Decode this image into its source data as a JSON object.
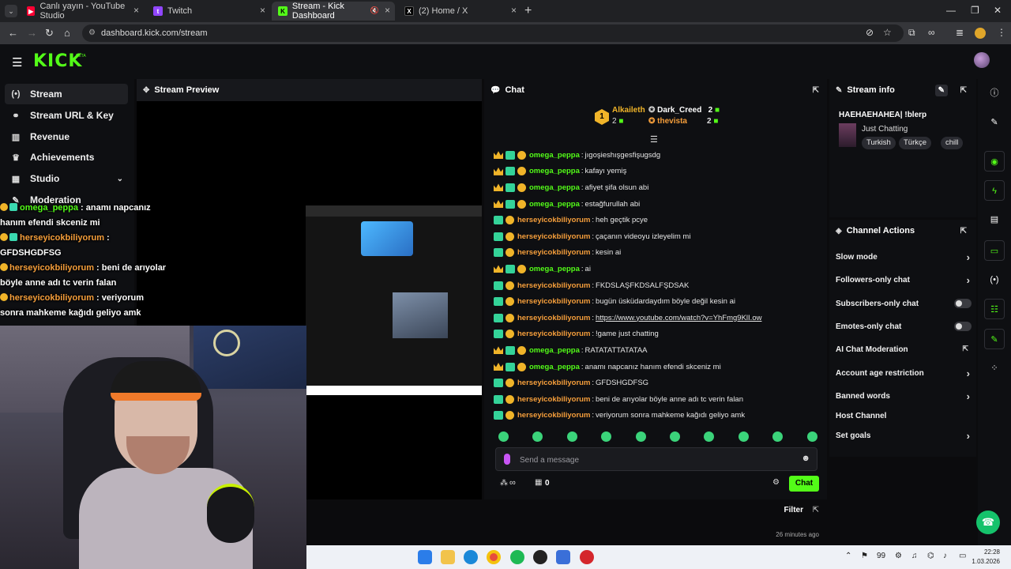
{
  "browser": {
    "tabs": [
      {
        "title": "Canlı yayın - YouTube Studio",
        "favicon_color": "#ff0033"
      },
      {
        "title": "Twitch",
        "favicon_color": "#9146ff"
      },
      {
        "title": "Stream - Kick Dashboard",
        "favicon_color": "#53fc18"
      },
      {
        "title": "(2) Home / X",
        "favicon_color": "#000000"
      }
    ],
    "url": "dashboard.kick.com/stream"
  },
  "kick": {
    "logo": "KICK",
    "beta": "BETA",
    "accent": "#53fc18"
  },
  "nav": {
    "items": [
      {
        "label": "Stream",
        "icon": "broadcast-icon"
      },
      {
        "label": "Stream URL & Key",
        "icon": "link-icon"
      },
      {
        "label": "Revenue",
        "icon": "revenue-icon"
      },
      {
        "label": "Achievements",
        "icon": "trophy-icon"
      },
      {
        "label": "Studio",
        "icon": "studio-icon"
      },
      {
        "label": "Moderation",
        "icon": "wrench-icon"
      }
    ]
  },
  "preview": {
    "title": "Stream Preview",
    "overlay": [
      {
        "user": "omega_peppa",
        "text": "anamı napcanız hanım efendi skceniz mi"
      },
      {
        "user": "herseyicokbiliyorum",
        "text": "GFDSHGDFSG"
      },
      {
        "user": "herseyicokbiliyorum",
        "text": "beni de arıyolar böyle anne adı tc verin falan"
      },
      {
        "user": "herseyicokbiliyorum",
        "text": "veriyorum sonra mahkeme kağıdı geliyo amk"
      }
    ]
  },
  "chat": {
    "title": "Chat",
    "leaderboard": {
      "first": {
        "name": "Alkaileth",
        "count": "2"
      },
      "second": {
        "name": "Dark_Creed",
        "count": "2"
      },
      "third": {
        "name": "thevista",
        "count": "2"
      },
      "rank": "1"
    },
    "messages": [
      {
        "user": "omega_peppa",
        "color": "green",
        "crown": true,
        "text": "jıgoşieshışgesfişugsdg"
      },
      {
        "user": "omega_peppa",
        "color": "green",
        "crown": true,
        "text": "kafayı yemiş"
      },
      {
        "user": "omega_peppa",
        "color": "green",
        "crown": true,
        "text": "afiyet şifa olsun abi"
      },
      {
        "user": "omega_peppa",
        "color": "green",
        "crown": true,
        "text": "estağfurullah abi"
      },
      {
        "user": "herseyicokbiliyorum",
        "color": "orange",
        "crown": false,
        "text": "heh geçtik pcye"
      },
      {
        "user": "herseyicokbiliyorum",
        "color": "orange",
        "crown": false,
        "text": "çaçanın videoyu izleyelim mi"
      },
      {
        "user": "herseyicokbiliyorum",
        "color": "orange",
        "crown": false,
        "text": "kesin ai"
      },
      {
        "user": "omega_peppa",
        "color": "green",
        "crown": true,
        "text": "ai"
      },
      {
        "user": "herseyicokbiliyorum",
        "color": "orange",
        "crown": false,
        "text": "FKDSLAŞFKDSALFŞDSAK"
      },
      {
        "user": "herseyicokbiliyorum",
        "color": "orange",
        "crown": false,
        "text": "bugün üsküdardaydım böyle değil kesin ai"
      },
      {
        "user": "herseyicokbiliyorum",
        "color": "orange",
        "crown": false,
        "text": "https://www.youtube.com/watch?v=YhFmg9KlI.ow",
        "link": true
      },
      {
        "user": "herseyicokbiliyorum",
        "color": "orange",
        "crown": false,
        "text": "!game just chatting"
      },
      {
        "user": "omega_peppa",
        "color": "green",
        "crown": true,
        "text": "RATATATTATATAA"
      },
      {
        "user": "omega_peppa",
        "color": "green",
        "crown": true,
        "text": "anamı napcanız hanım efendi skceniz mi"
      },
      {
        "user": "herseyicokbiliyorum",
        "color": "orange",
        "crown": false,
        "text": "GFDSHGDFSG"
      },
      {
        "user": "herseyicokbiliyorum",
        "color": "orange",
        "crown": false,
        "text": "beni de arıyolar böyle anne adı tc verin falan"
      },
      {
        "user": "herseyicokbiliyorum",
        "color": "orange",
        "crown": false,
        "text": "veriyorum sonra mahkeme kağıdı geliyo amk"
      }
    ],
    "placeholder": "Send a message",
    "points": "∞",
    "gifts": "0",
    "send_label": "Chat"
  },
  "bottom": {
    "filter": "Filter",
    "ago": "26 minutes ago"
  },
  "stream_info": {
    "title": "Stream info",
    "stream_title": "HAEHAEHAHEA| !blerp",
    "category": "Just Chatting",
    "tags": [
      "Turkish",
      "Türkçe",
      "chill"
    ]
  },
  "channel_actions": {
    "title": "Channel Actions",
    "items": [
      {
        "label": "Slow mode",
        "kind": "chevron"
      },
      {
        "label": "Followers-only chat",
        "kind": "chevron"
      },
      {
        "label": "Subscribers-only chat",
        "kind": "toggle"
      },
      {
        "label": "Emotes-only chat",
        "kind": "toggle"
      },
      {
        "label": "AI Chat Moderation",
        "kind": "external"
      },
      {
        "label": "Account age restriction",
        "kind": "chevron"
      },
      {
        "label": "Banned words",
        "kind": "chevron"
      },
      {
        "label": "Host Channel",
        "kind": "none"
      },
      {
        "label": "Set goals",
        "kind": "chevron"
      }
    ]
  },
  "taskbar": {
    "tray_count": "99",
    "time": "22:28",
    "date": "1.03.2026"
  }
}
